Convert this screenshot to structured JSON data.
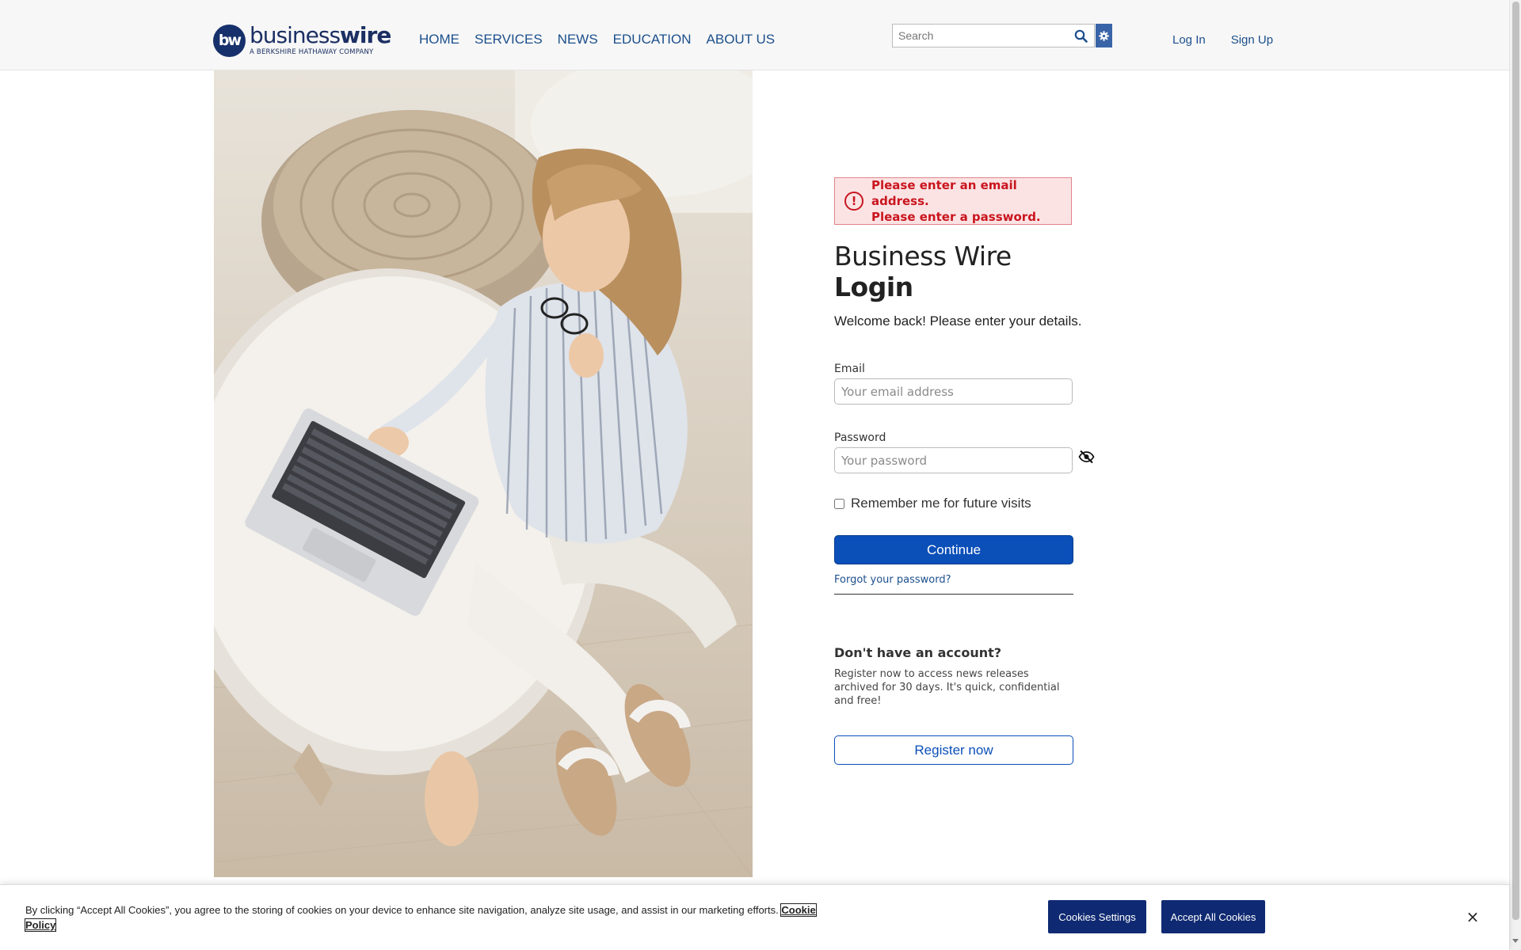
{
  "header": {
    "logo": {
      "mark": "bw",
      "word_light": "business",
      "word_bold": "wire",
      "tagline": "A BERKSHIRE HATHAWAY COMPANY"
    },
    "nav": [
      "HOME",
      "SERVICES",
      "NEWS",
      "EDUCATION",
      "ABOUT US"
    ],
    "search": {
      "placeholder": "Search",
      "icon": "search-icon",
      "settings_icon": "gear-icon"
    },
    "auth": {
      "login": "Log In",
      "signup": "Sign Up"
    }
  },
  "login": {
    "alert": {
      "icon": "exclamation-circle-icon",
      "messages": [
        "Please enter an email address.",
        "Please enter a password."
      ]
    },
    "title_light": "Business Wire",
    "title_bold": "Login",
    "welcome": "Welcome back! Please enter your details.",
    "email": {
      "label": "Email",
      "placeholder": "Your email address",
      "value": ""
    },
    "password": {
      "label": "Password",
      "placeholder": "Your password",
      "value": "",
      "toggle_icon": "eye-slash-icon"
    },
    "remember_label": "Remember me for future visits",
    "remember_checked": false,
    "continue_label": "Continue",
    "forgot_label": "Forgot your password?",
    "no_account_heading": "Don't have an account?",
    "register_text": "Register now to access news releases archived for 30 days. It's quick, confidential and free!",
    "register_label": "Register now"
  },
  "cookie_banner": {
    "text": "By clicking “Accept All Cookies”, you agree to the storing of cookies on your device to enhance site navigation, analyze site usage, and assist in our marketing efforts.",
    "policy_link": "Cookie Policy",
    "settings_label": "Cookies Settings",
    "accept_label": "Accept All Cookies",
    "close_label": "×"
  },
  "colors": {
    "brand_navy": "#1b2f63",
    "link_blue": "#1c4f8c",
    "primary_button": "#0b4fb8",
    "error_red": "#c9151e",
    "error_bg": "#fbe3e4",
    "cookie_button": "#0f2a72"
  }
}
